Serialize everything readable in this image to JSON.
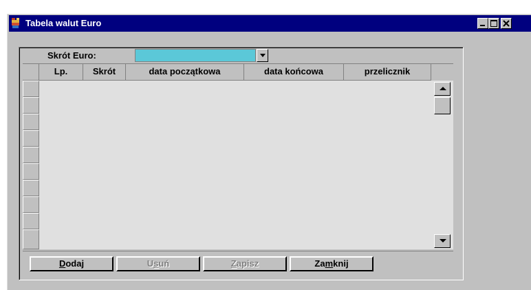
{
  "window": {
    "title": "Tabela walut Euro"
  },
  "filter": {
    "label": "Skrót Euro:",
    "value": ""
  },
  "table": {
    "columns": [
      "Lp.",
      "Skrót",
      "data początkowa",
      "data końcowa",
      "przelicznik"
    ],
    "rows": []
  },
  "buttons": [
    {
      "pre": "",
      "key": "D",
      "post": "odaj",
      "enabled": true
    },
    {
      "pre": "U",
      "key": "s",
      "post": "uń",
      "enabled": false
    },
    {
      "pre": "",
      "key": "Z",
      "post": "apisz",
      "enabled": false
    },
    {
      "pre": "Za",
      "key": "m",
      "post": "knij",
      "enabled": true
    }
  ],
  "colors": {
    "titlebar": "#00007f",
    "face": "#c0c0c0",
    "grid_background": "#e0e0e0",
    "active_input": "#5bc8d8"
  },
  "icons": {
    "app": "currency-table-icon",
    "minimize": "minimize-icon",
    "maximize": "maximize-icon",
    "close": "close-icon",
    "dropdown": "chevron-down-icon",
    "scroll_up": "arrow-up-icon",
    "scroll_down": "arrow-down-icon"
  }
}
